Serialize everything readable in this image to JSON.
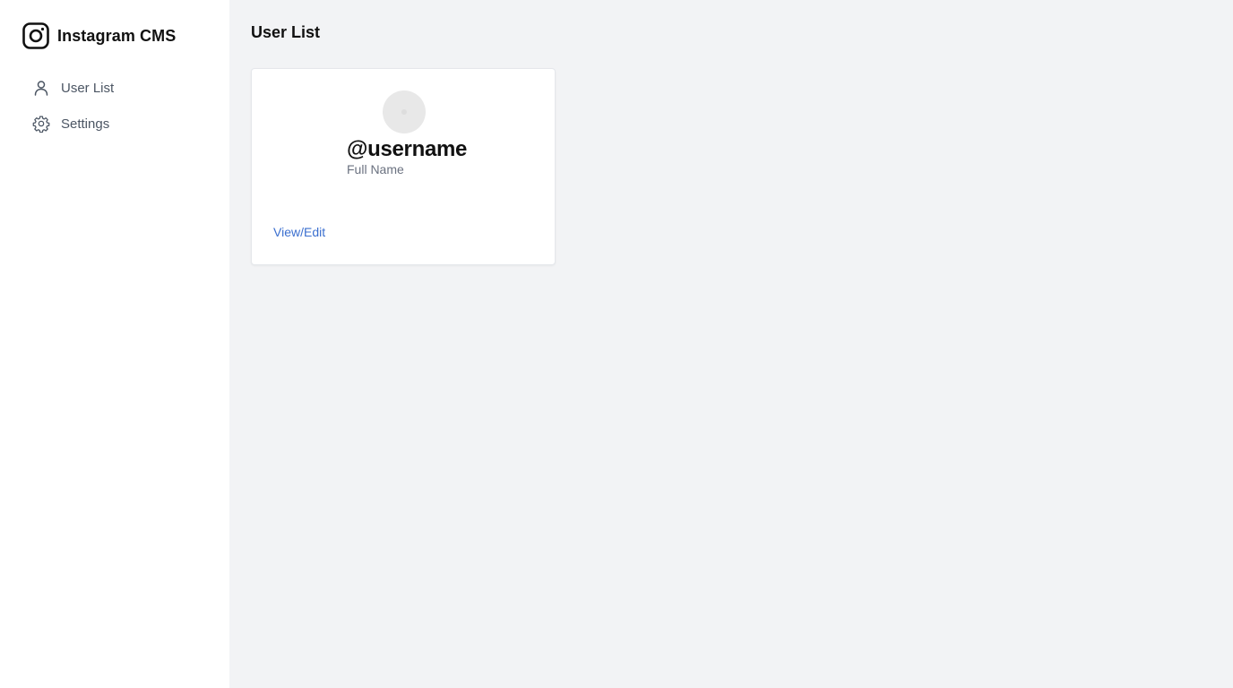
{
  "sidebar": {
    "brand": {
      "icon": "instagram-icon",
      "title": "Instagram CMS"
    },
    "items": [
      {
        "label": "User List",
        "icon": "user-icon"
      },
      {
        "label": "Settings",
        "icon": "gear-icon"
      }
    ]
  },
  "main": {
    "page_title": "User List",
    "cards": [
      {
        "avatar": "avatar-placeholder",
        "username": "@username",
        "full_name": "Full Name",
        "action_label": "View/Edit"
      }
    ]
  },
  "colors": {
    "link": "#3b6fcf",
    "background": "#f2f3f5",
    "sidebar": "#ffffff"
  }
}
